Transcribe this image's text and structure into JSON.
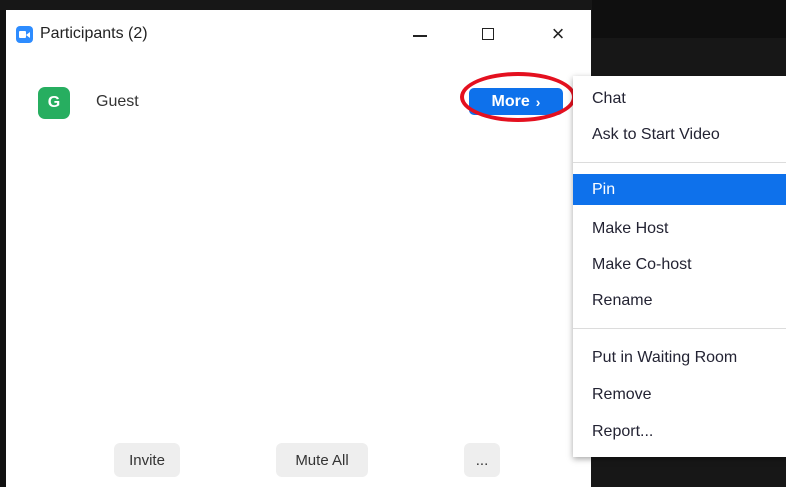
{
  "window": {
    "title": "Participants (2)",
    "controls": {
      "minimize": "minimize",
      "maximize": "maximize",
      "close": "×"
    }
  },
  "participants": [
    {
      "initial": "G",
      "name": "Guest",
      "avatar_color": "#27ae60"
    }
  ],
  "more_button": {
    "label": "More",
    "chevron": "›"
  },
  "footer": {
    "invite_label": "Invite",
    "mute_all_label": "Mute All",
    "more_label": "..."
  },
  "context_menu": {
    "groups": [
      [
        "Chat",
        "Ask to Start Video"
      ],
      [
        "Pin",
        "Make Host",
        "Make Co-host",
        "Rename"
      ],
      [
        "Put in Waiting Room",
        "Remove",
        "Report..."
      ]
    ],
    "highlighted": "Pin"
  },
  "colors": {
    "accent": "#0e71eb",
    "highlight_ring": "#e4101f"
  }
}
